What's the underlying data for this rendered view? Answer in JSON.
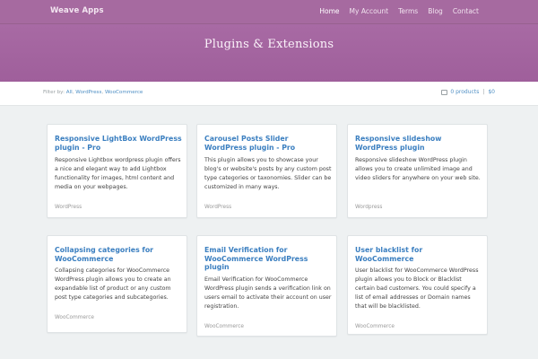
{
  "header": {
    "brand": "Weave Apps",
    "nav": [
      "Home",
      "My Account",
      "Terms",
      "Blog",
      "Contact"
    ]
  },
  "hero": {
    "title": "Plugins & Extensions"
  },
  "filter": {
    "label": "Filter by:",
    "options": [
      "All",
      "WordPress",
      "WooCommerce"
    ],
    "separators": [
      ",",
      ","
    ]
  },
  "cart": {
    "products": "0 products",
    "separator": "|",
    "total": "$0"
  },
  "products": [
    {
      "title": "Responsive LightBox WordPress plugin - Pro",
      "description": "Responsive Lightbox wordpress plugin offers a nice and elegant way to add Lightbox functionality for images, html content and media on your webpages.",
      "category": "WordPress"
    },
    {
      "title": "Carousel Posts Slider WordPress plugin - Pro",
      "description": "This plugin allows you to showcase your blog's or website's posts by any custom post type categories or taxonomies. Slider can be customized in many ways.",
      "category": "WordPress"
    },
    {
      "title": "Responsive slideshow WordPress plugin",
      "description": "Responsive slideshow WordPress plugin allows you to create unlimited image and video sliders for anywhere on your web site.",
      "category": "Wordpress"
    },
    {
      "title": "Collapsing categories for WooCommerce",
      "description": "Collapsing categories for WooCommerce WordPress plugin allows you to create an expandable list of product or any custom post type categories and subcategories.",
      "category": "WooCommerce"
    },
    {
      "title": "Email Verification for WooCommerce WordPress plugin",
      "description": "Email Verification for WooCommerce WordPress plugin sends a verification link on users email to activate their account on user registration.",
      "category": "WooCommerce"
    },
    {
      "title": "User blacklist for WooCommerce",
      "description": "User blacklist for WooCommerce WordPress plugin allows you to Block or Blacklist certain bad customers. You could specify a list of email addresses or Domain names that will be blacklisted.",
      "category": "WooCommerce"
    }
  ],
  "colors": {
    "header_bg": "#a66aa0",
    "link": "#3b7fc0",
    "page_bg": "#eef1f2"
  }
}
